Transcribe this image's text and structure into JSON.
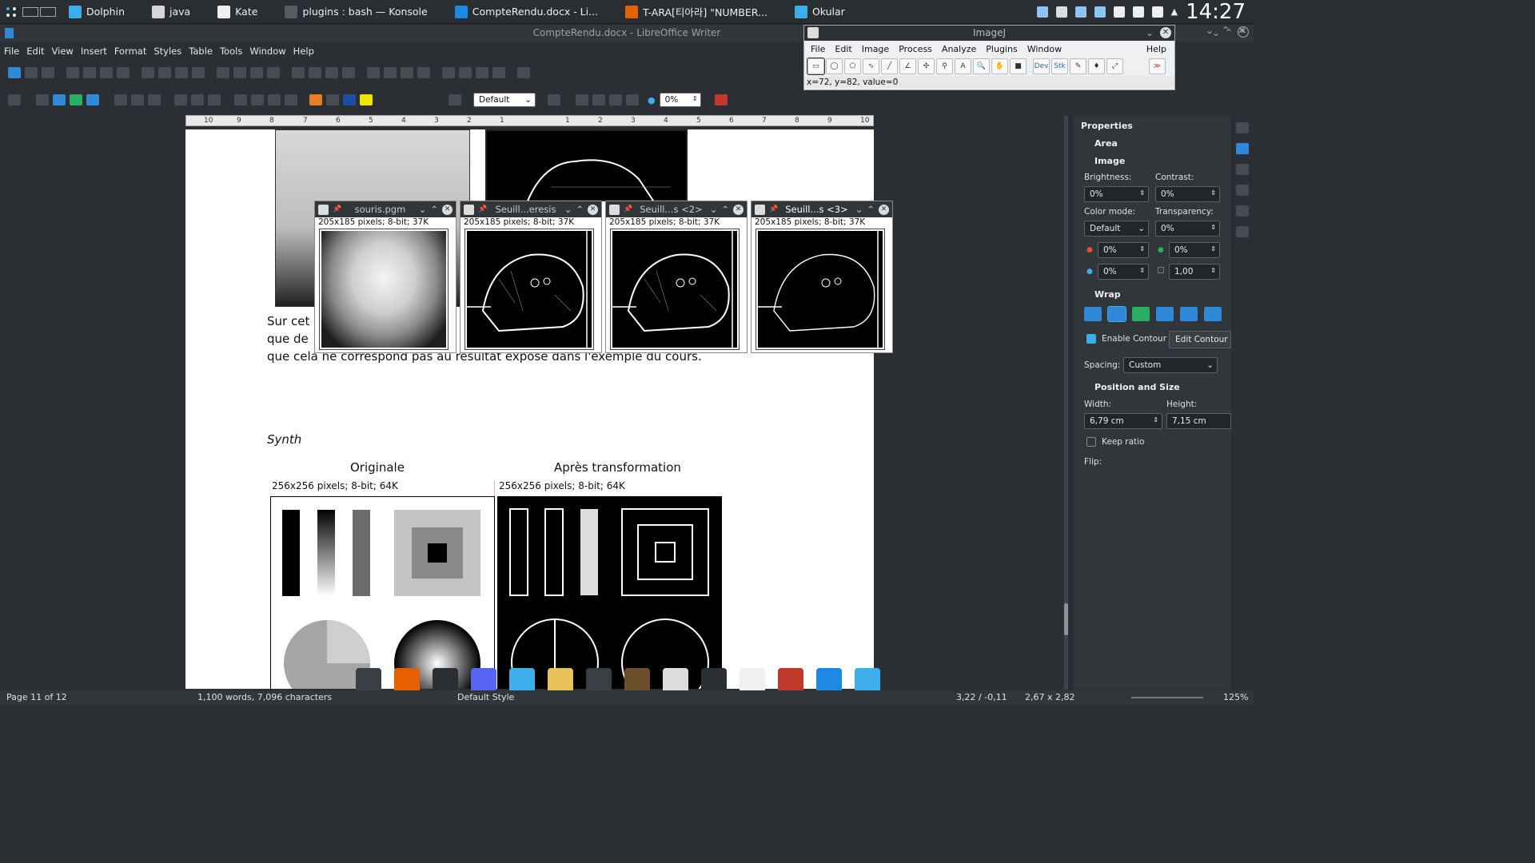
{
  "taskbar": {
    "tasks": [
      {
        "label": "Dolphin",
        "icon": "dolphin-icon",
        "color": "#3daee9"
      },
      {
        "label": "java",
        "icon": "java-icon",
        "color": "#d6d6d6"
      },
      {
        "label": "Kate",
        "icon": "kate-icon",
        "color": "#eeeeee"
      },
      {
        "label": "plugins : bash — Konsole",
        "icon": "terminal-icon",
        "color": "#555b62"
      },
      {
        "label": "CompteRendu.docx - Li...",
        "icon": "writer-icon",
        "color": "#1e88e5"
      },
      {
        "label": "T-ARA[티아라] \"NUMBER...",
        "icon": "firefox-icon",
        "color": "#e66000"
      },
      {
        "label": "Okular",
        "icon": "okular-icon",
        "color": "#3daee9"
      }
    ],
    "clock": "14:27"
  },
  "writer": {
    "title": "CompteRendu.docx - LibreOffice Writer",
    "menu": [
      "File",
      "Edit",
      "View",
      "Insert",
      "Format",
      "Styles",
      "Table",
      "Tools",
      "Window",
      "Help"
    ],
    "style_value": "Default",
    "percent_value": "0%",
    "ruler_ticks": [
      "10",
      "9",
      "8",
      "7",
      "6",
      "5",
      "4",
      "3",
      "2",
      "1",
      "1",
      "2",
      "3",
      "4",
      "5",
      "6",
      "7",
      "8",
      "9",
      "10"
    ],
    "doc": {
      "para_lines": [
        "Sur cet",
        "que de",
        "que cela ne correspond pas au résultat exposé dans l'exemple du cours."
      ],
      "synth_heading": "Synth",
      "col_left": "Originale",
      "col_right": "Après transformation",
      "img_info_left": "256x256 pixels; 8-bit; 64K",
      "img_info_right": "256x256 pixels; 8-bit; 64K"
    }
  },
  "imagej": {
    "title": "ImageJ",
    "menu": [
      "File",
      "Edit",
      "Image",
      "Process",
      "Analyze",
      "Plugins",
      "Window",
      "Help"
    ],
    "tools": [
      "rectangle-tool",
      "oval-tool",
      "polygon-tool",
      "freehand-tool",
      "line-tool",
      "angle-tool",
      "point-tool",
      "wand-tool",
      "text-tool",
      "zoom-tool",
      "hand-tool",
      "color-picker-tool",
      "Dev",
      "Stk",
      "pencil-tool",
      "brush-tool",
      "dropper-tool",
      "more-tools"
    ],
    "dev_label": "Dev",
    "stk_label": "Stk",
    "more_label": "≫",
    "status": "x=72, y=82, value=0"
  },
  "image_windows": [
    {
      "title": "souris.pgm",
      "info": "205x185 pixels; 8-bit; 37K"
    },
    {
      "title": "Seuill...eresis",
      "info": "205x185 pixels; 8-bit; 37K"
    },
    {
      "title": "Seuill...s <2>",
      "info": "205x185 pixels; 8-bit; 37K"
    },
    {
      "title": "Seuill...s <3>",
      "info": "205x185 pixels; 8-bit; 37K"
    }
  ],
  "properties": {
    "title": "Properties",
    "area": "Area",
    "image": "Image",
    "brightness_label": "Brightness:",
    "brightness": "0%",
    "contrast_label": "Contrast:",
    "contrast": "0%",
    "color_mode_label": "Color mode:",
    "color_mode": "Default",
    "transparency_label": "Transparency:",
    "transparency": "0%",
    "red": "0%",
    "green": "0%",
    "blue": "0%",
    "gamma": "1,00",
    "wrap": "Wrap",
    "enable_contour": "Enable Contour",
    "edit_contour": "Edit Contour",
    "spacing_label": "Spacing:",
    "spacing": "Custom",
    "pos_size": "Position and Size",
    "width_label": "Width:",
    "width": "6,79 cm",
    "height_label": "Height:",
    "height": "7,15 cm",
    "keep_ratio": "Keep ratio",
    "flip": "Flip:"
  },
  "status": {
    "page": "Page 11 of 12",
    "words": "1,100 words, 7,096 characters",
    "style": "Default Style",
    "pos": "3,22 / -0,11",
    "size": "2,67 x 2,82",
    "zoom": "125%"
  },
  "dock": [
    "settings-icon",
    "firefox-icon",
    "image-viewer-icon",
    "discord-icon",
    "folder-icon",
    "game-icon",
    "terminal-icon",
    "microscope-icon",
    "kde-icon",
    "terminal2-icon",
    "document-icon",
    "ide-icon",
    "writer-icon",
    "kate-icon"
  ]
}
